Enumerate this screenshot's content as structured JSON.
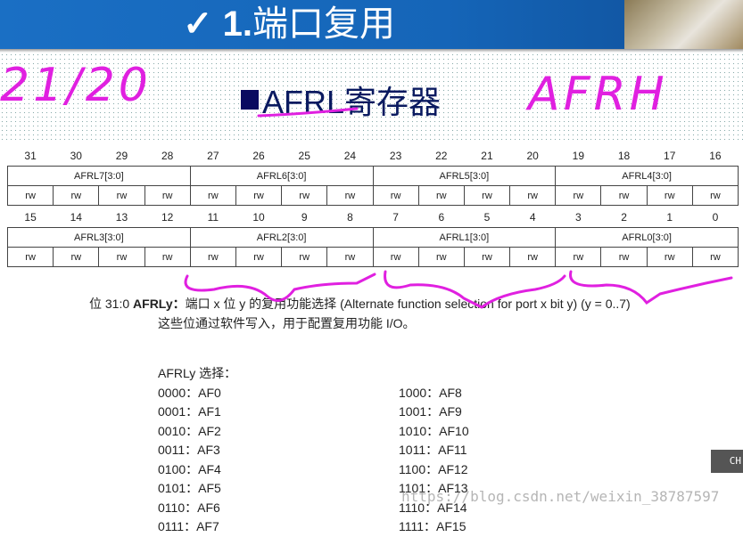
{
  "header": {
    "check": "✓",
    "number": "1.",
    "title": "端口复用"
  },
  "subtitle": {
    "name": "AFRL",
    "suffix": "寄存器"
  },
  "handwriting": {
    "left": "21/20",
    "right": "AFRH"
  },
  "register": {
    "row1_bits": [
      "31",
      "30",
      "29",
      "28",
      "27",
      "26",
      "25",
      "24",
      "23",
      "22",
      "21",
      "20",
      "19",
      "18",
      "17",
      "16"
    ],
    "row1_fields": [
      "AFRL7[3:0]",
      "AFRL6[3:0]",
      "AFRL5[3:0]",
      "AFRL4[3:0]"
    ],
    "row2_bits": [
      "15",
      "14",
      "13",
      "12",
      "11",
      "10",
      "9",
      "8",
      "7",
      "6",
      "5",
      "4",
      "3",
      "2",
      "1",
      "0"
    ],
    "row2_fields": [
      "AFRL3[3:0]",
      "AFRL2[3:0]",
      "AFRL1[3:0]",
      "AFRL0[3:0]"
    ],
    "access": "rw"
  },
  "description": {
    "bits": "位 31:0",
    "field": "AFRLy：",
    "text": "端口 x 位 y 的复用功能选择 (Alternate function selection for port x bit y) (y = 0..7)",
    "line2": "这些位通过软件写入，用于配置复用功能 I/O。",
    "select_label": "AFRLy 选择：",
    "options": [
      "0000：AF0",
      "1000：AF8",
      "0001：AF1",
      "1001：AF9",
      "0010：AF2",
      "1010：AF10",
      "0011：AF3",
      "1011：AF11",
      "0100：AF4",
      "1100：AF12",
      "0101：AF5",
      "1101：AF13",
      "0110：AF6",
      "1110：AF14",
      "0111：AF7",
      "1111：AF15"
    ]
  },
  "watermark": "https://blog.csdn.net/weixin_38787597",
  "ime": "CH",
  "colors": {
    "header": "#1565b8",
    "ink": "#e020e0",
    "title": "#0a1a60"
  }
}
